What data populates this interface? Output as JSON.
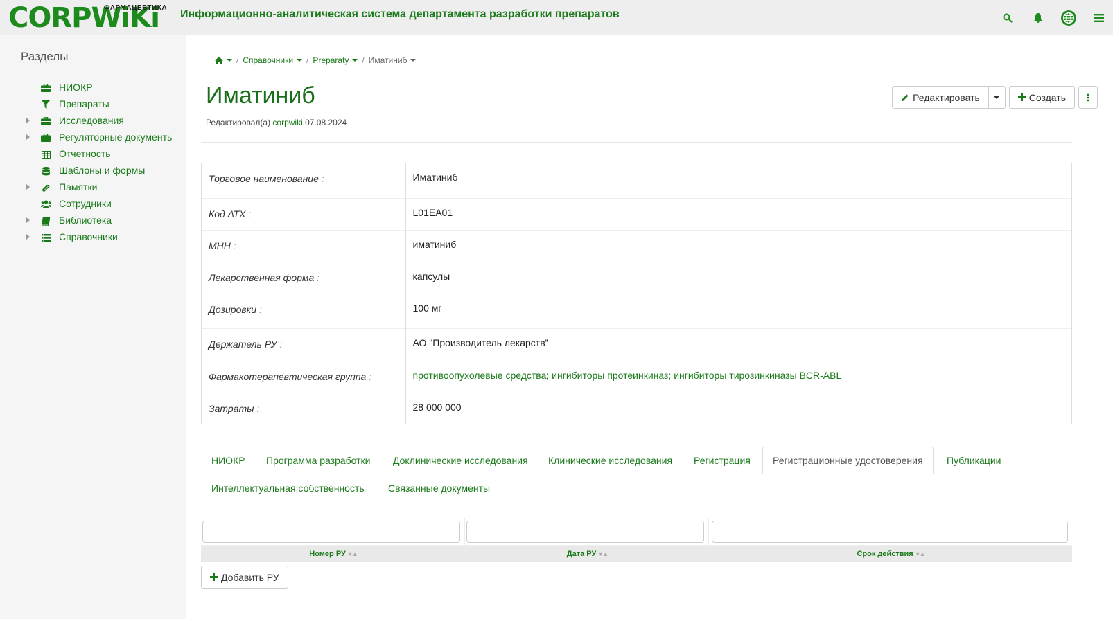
{
  "header": {
    "logo_main": "CORPWiKi",
    "logo_sub": "ФАРМАЦЕВТИКА",
    "app_title": "Информационно-аналитическая система департамента разработки препаратов",
    "icons": [
      "search-icon",
      "bell-icon",
      "globe-icon",
      "menu-icon"
    ]
  },
  "sidebar": {
    "title": "Разделы",
    "items": [
      {
        "label": "НИОКР",
        "icon": "briefcase-icon",
        "expandable": false
      },
      {
        "label": "Препараты",
        "icon": "filter-icon",
        "expandable": false
      },
      {
        "label": "Исследования",
        "icon": "briefcase-icon",
        "expandable": true
      },
      {
        "label": "Регуляторные документь",
        "icon": "briefcase-icon",
        "expandable": true
      },
      {
        "label": "Отчетность",
        "icon": "table-icon",
        "expandable": false
      },
      {
        "label": "Шаблоны и формы",
        "icon": "database-icon",
        "expandable": false
      },
      {
        "label": "Памятки",
        "icon": "paperclip-icon",
        "expandable": true
      },
      {
        "label": "Сотрудники",
        "icon": "users-icon",
        "expandable": false
      },
      {
        "label": "Библиотека",
        "icon": "book-icon",
        "expandable": true
      },
      {
        "label": "Справочники",
        "icon": "list-icon",
        "expandable": true
      }
    ]
  },
  "breadcrumb": {
    "home_icon": "home-icon",
    "items": [
      "Справочники",
      "Preparaty",
      "Иматиниб"
    ]
  },
  "page": {
    "title": "Иматиниб",
    "edited_prefix": "Редактировал(а)",
    "edited_user": "corpwiki",
    "edited_date": "07.08.2024"
  },
  "actions": {
    "edit_label": "Редактировать",
    "create_label": "Создать"
  },
  "details": [
    {
      "label": "Торговое наименование",
      "value": "Иматиниб",
      "link": false
    },
    {
      "label": "Код АТХ",
      "value": "L01EA01",
      "link": false
    },
    {
      "label": "МНН",
      "value": "иматиниб",
      "link": false
    },
    {
      "label": "Лекарственная форма",
      "value": "капсулы",
      "link": false
    },
    {
      "label": "Дозировки",
      "value": "100 мг",
      "link": false
    },
    {
      "label": "Держатель РУ",
      "value": "АО \"Производитель лекарств\"",
      "link": false
    },
    {
      "label": "Фармакотерапевтическая группа",
      "value": "противоопухолевые средства; ингибиторы протеинкиназ; ингибиторы тирозинкиназы BCR-ABL",
      "link": true
    },
    {
      "label": "Затраты",
      "value": "28 000 000",
      "link": false
    }
  ],
  "tabs": [
    {
      "label": "НИОКР",
      "active": false
    },
    {
      "label": "Программа разработки",
      "active": false
    },
    {
      "label": "Доклинические исследования",
      "active": false
    },
    {
      "label": "Клинические исследования",
      "active": false
    },
    {
      "label": "Регистрация",
      "active": false
    },
    {
      "label": "Регистрационные удостоверения",
      "active": true
    },
    {
      "label": "Публикации",
      "active": false
    },
    {
      "label": "Интеллектуальная собственность",
      "active": false
    },
    {
      "label": "Связанные документы",
      "active": false
    }
  ],
  "grid": {
    "columns": [
      "Номер РУ",
      "Дата РУ",
      "Срок действия"
    ],
    "add_label": "Добавить РУ"
  },
  "colors": {
    "brand": "#1c8a1c",
    "link": "#1a7a1a"
  }
}
